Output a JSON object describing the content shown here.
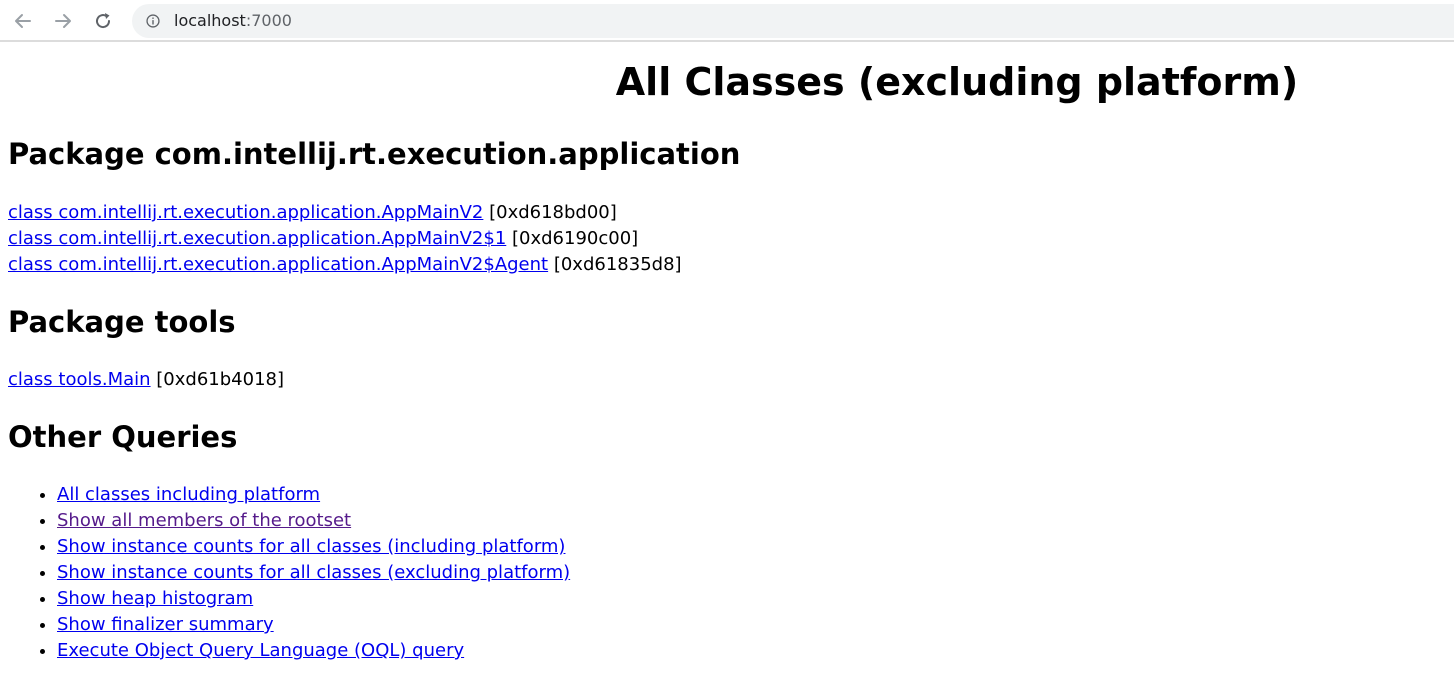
{
  "browser": {
    "url_host": "localhost",
    "url_port": ":7000",
    "back_icon": "arrow-left-icon",
    "forward_icon": "arrow-right-icon",
    "reload_icon": "reload-icon",
    "info_icon": "info-icon"
  },
  "page": {
    "title": "All Classes (excluding platform)"
  },
  "packages": [
    {
      "heading": "Package com.intellij.rt.execution.application",
      "classes": [
        {
          "link": "class com.intellij.rt.execution.application.AppMainV2",
          "addr": " [0xd618bd00]"
        },
        {
          "link": "class com.intellij.rt.execution.application.AppMainV2$1",
          "addr": " [0xd6190c00]"
        },
        {
          "link": "class com.intellij.rt.execution.application.AppMainV2$Agent",
          "addr": " [0xd61835d8]"
        }
      ]
    },
    {
      "heading": "Package tools",
      "classes": [
        {
          "link": "class tools.Main",
          "addr": " [0xd61b4018]"
        }
      ]
    }
  ],
  "other_queries": {
    "heading": "Other Queries",
    "items": [
      "All classes including platform",
      "Show all members of the rootset",
      "Show instance counts for all classes (including platform)",
      "Show instance counts for all classes (excluding platform)",
      "Show heap histogram",
      "Show finalizer summary",
      "Execute Object Query Language (OQL) query"
    ],
    "visited_index": 1
  },
  "colors": {
    "link": "#0000ee",
    "visited_link": "#551a8b",
    "omnibox_bg": "#f1f3f4"
  }
}
